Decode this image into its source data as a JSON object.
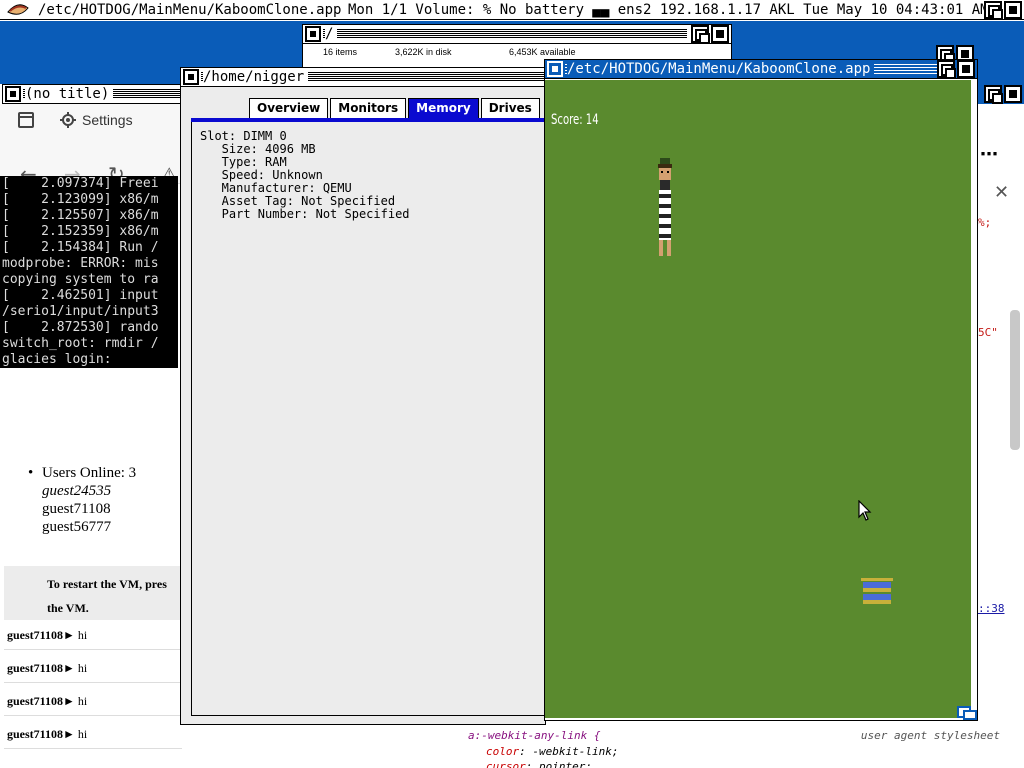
{
  "topbar": {
    "title": "/etc/HOTDOG/MainMenu/KaboomClone.app",
    "status": "Mon 1/1 Volume: % No battery ▄▄ ens2 192.168.1.17 AKL Tue May 10 04:43:01 AM"
  },
  "file_window": {
    "title": "/",
    "items": "16 items",
    "disk": "3,622K in disk",
    "available": "6,453K available"
  },
  "browser": {
    "window_title": "(no title)",
    "tab_label": "Settings",
    "console_lines": [
      "[    2.097374] Freei",
      "[    2.123099] x86/m",
      "[    2.125507] x86/m",
      "[    2.152359] x86/m",
      "[    2.154384] Run /",
      "modprobe: ERROR: mis",
      "copying system to ra",
      "[    2.462501] input",
      "/serio1/input/input3",
      "[    2.872530] rando",
      "switch_root: rmdir /",
      "glacies login:"
    ],
    "users_header": "Users Online: 3",
    "users": [
      "guest24535",
      "guest71108",
      "guest56777"
    ],
    "restart_line1": "To restart the VM, pres",
    "restart_line2": "the VM.",
    "chat": [
      {
        "user": "guest71108",
        "msg": "hi"
      },
      {
        "user": "guest71108",
        "msg": "hi"
      },
      {
        "user": "guest71108",
        "msg": "hi"
      },
      {
        "user": "guest71108",
        "msg": "hi"
      }
    ]
  },
  "devtools": {
    "more": "⋯",
    "close": "✕",
    "code1": "%;",
    "code2": "5C\"",
    "code3": "::38",
    "selector": "a:-webkit-any-link {",
    "ua_label": "user agent stylesheet",
    "prop1_name": "color",
    "prop1_value": "-webkit-link;",
    "prop2_name": "cursor",
    "prop2_value": "pointer;"
  },
  "hw_window": {
    "title": "/home/nigger",
    "tabs": [
      "Overview",
      "Monitors",
      "Memory",
      "Drives"
    ],
    "active_tab": "Memory",
    "memory_info": "Slot: DIMM 0\n   Size: 4096 MB\n   Type: RAM\n   Speed: Unknown\n   Manufacturer: QEMU\n   Asset Tag: Not Specified\n   Part Number: Not Specified"
  },
  "kaboom": {
    "title": "/etc/HOTDOG/MainMenu/KaboomClone.app",
    "score": "Score: 14",
    "field_color": "#5a8a2e"
  },
  "colors": {
    "desktop_blue": "#0a5cb8",
    "tab_active": "#0a0ad0"
  }
}
